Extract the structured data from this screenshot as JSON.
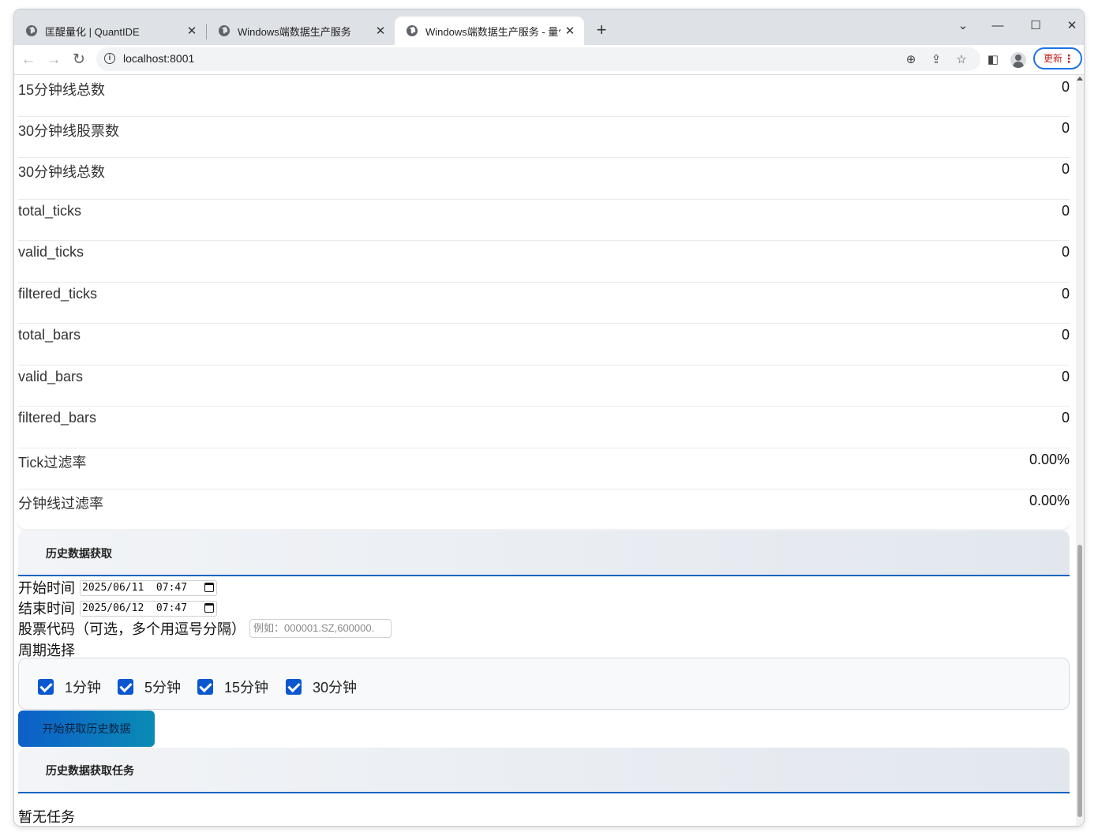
{
  "tabs": [
    {
      "title": "匡醍量化 | QuantIDE",
      "active": false
    },
    {
      "title": "Windows端数据生产服务",
      "active": false
    },
    {
      "title": "Windows端数据生产服务 - 量化",
      "active": true
    }
  ],
  "toolbar": {
    "url": "localhost:8001",
    "update_label": "更新"
  },
  "stats": [
    {
      "label": "15分钟线总数",
      "value": "0"
    },
    {
      "label": "30分钟线股票数",
      "value": "0"
    },
    {
      "label": "30分钟线总数",
      "value": "0"
    },
    {
      "label": "total_ticks",
      "value": "0"
    },
    {
      "label": "valid_ticks",
      "value": "0"
    },
    {
      "label": "filtered_ticks",
      "value": "0"
    },
    {
      "label": "total_bars",
      "value": "0"
    },
    {
      "label": "valid_bars",
      "value": "0"
    },
    {
      "label": "filtered_bars",
      "value": "0"
    },
    {
      "label": "Tick过滤率",
      "value": "0.00%"
    },
    {
      "label": "分钟线过滤率",
      "value": "0.00%"
    }
  ],
  "history_panel": {
    "title": "历史数据获取",
    "start_label": "开始时间",
    "start_value": "2025/06/11  07:47",
    "end_label": "结束时间",
    "end_value": "2025/06/12  07:47",
    "codes_label": "股票代码（可选，多个用逗号分隔）",
    "codes_placeholder": "例如：000001.SZ,600000.",
    "period_label": "周期选择",
    "periods": [
      {
        "label": "1分钟",
        "checked": true
      },
      {
        "label": "5分钟",
        "checked": true
      },
      {
        "label": "15分钟",
        "checked": true
      },
      {
        "label": "30分钟",
        "checked": true
      }
    ],
    "start_button": "开始获取历史数据"
  },
  "tasks_panel": {
    "title": "历史数据获取任务",
    "empty_text": "暂无任务"
  }
}
